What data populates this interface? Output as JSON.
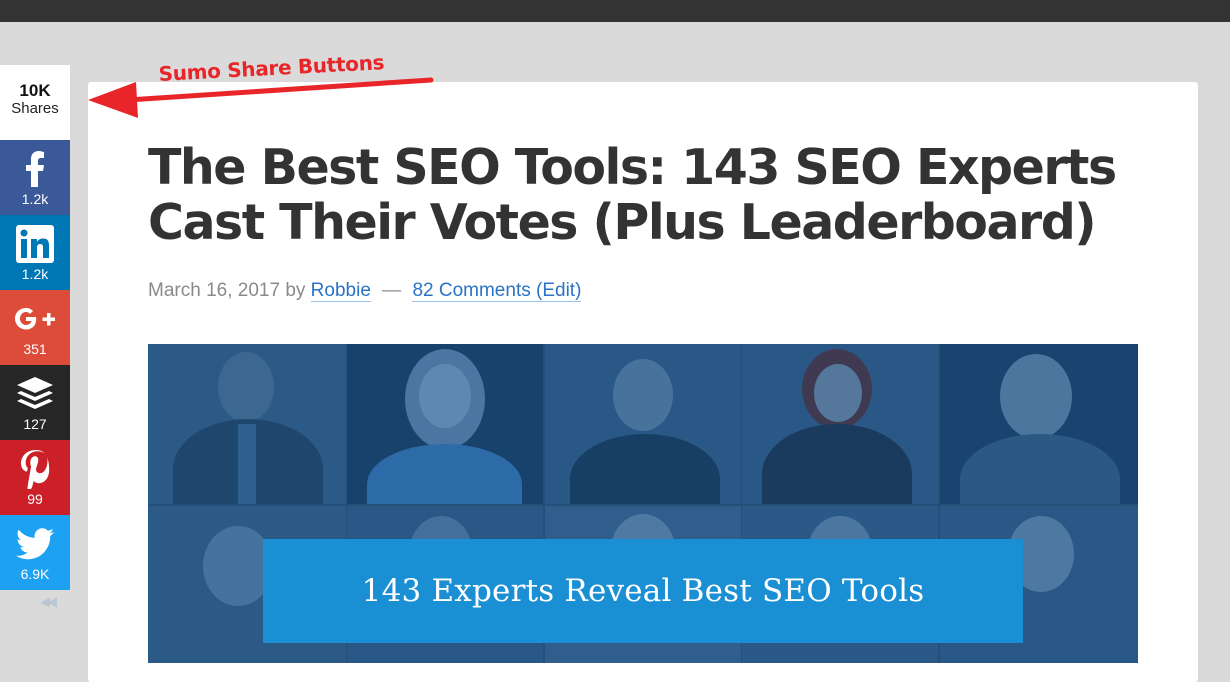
{
  "share": {
    "total_count": "10K",
    "total_label": "Shares",
    "buttons": [
      {
        "network": "facebook",
        "icon": "facebook-icon",
        "count": "1.2k",
        "color": "#3b5998"
      },
      {
        "network": "linkedin",
        "icon": "linkedin-icon",
        "count": "1.2k",
        "color": "#0077b5"
      },
      {
        "network": "google-plus",
        "icon": "google-plus-icon",
        "count": "351",
        "color": "#dd4b39"
      },
      {
        "network": "buffer",
        "icon": "buffer-icon",
        "count": "127",
        "color": "#262626"
      },
      {
        "network": "pinterest",
        "icon": "pinterest-icon",
        "count": "99",
        "color": "#cb2027"
      },
      {
        "network": "twitter",
        "icon": "twitter-icon",
        "count": "6.9K",
        "color": "#1da1f2"
      }
    ]
  },
  "annotation": {
    "text": "Sumo Share Buttons",
    "color": "#e8262a"
  },
  "article": {
    "title": "The Best SEO Tools: 143 SEO Experts Cast Their Votes (Plus Leaderboard)",
    "date": "March 16, 2017",
    "by": "by",
    "author": "Robbie",
    "separator": "—",
    "comments": "82 Comments",
    "edit": "(Edit)",
    "hero_banner": "143 Experts Reveal Best SEO Tools"
  },
  "colors": {
    "topbar": "#333333",
    "background": "#dadada",
    "link": "#2a73c5",
    "banner": "#1a8fd4",
    "hero_overlay": "#244f79"
  }
}
